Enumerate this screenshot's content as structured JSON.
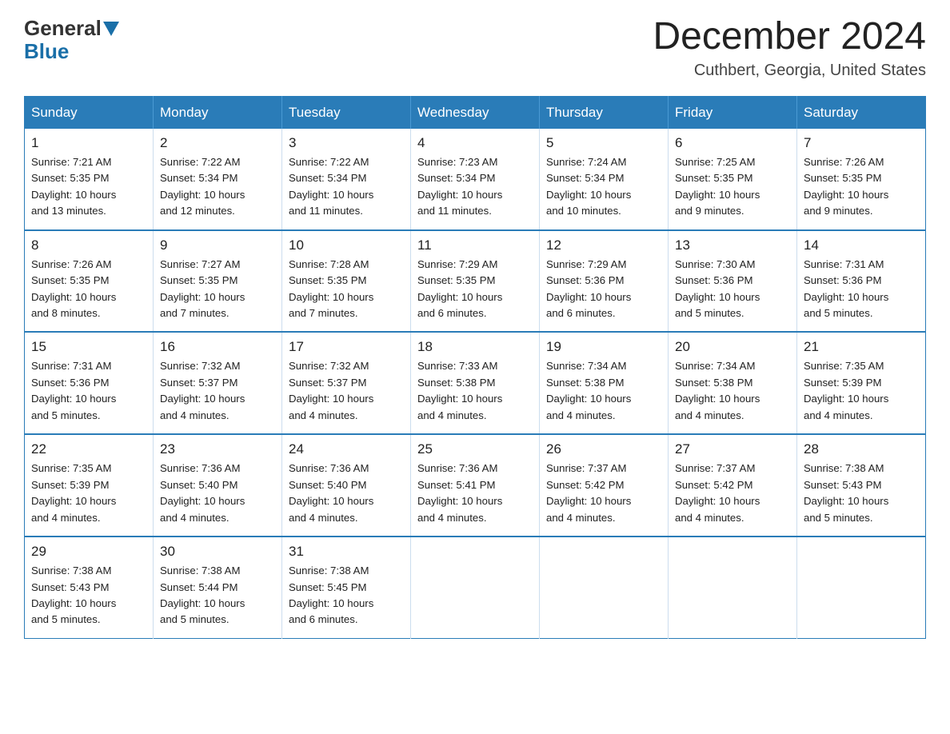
{
  "logo": {
    "general": "General",
    "blue": "Blue"
  },
  "header": {
    "title": "December 2024",
    "location": "Cuthbert, Georgia, United States"
  },
  "days_of_week": [
    "Sunday",
    "Monday",
    "Tuesday",
    "Wednesday",
    "Thursday",
    "Friday",
    "Saturday"
  ],
  "weeks": [
    [
      {
        "day": "1",
        "sunrise": "7:21 AM",
        "sunset": "5:35 PM",
        "daylight": "10 hours and 13 minutes."
      },
      {
        "day": "2",
        "sunrise": "7:22 AM",
        "sunset": "5:34 PM",
        "daylight": "10 hours and 12 minutes."
      },
      {
        "day": "3",
        "sunrise": "7:22 AM",
        "sunset": "5:34 PM",
        "daylight": "10 hours and 11 minutes."
      },
      {
        "day": "4",
        "sunrise": "7:23 AM",
        "sunset": "5:34 PM",
        "daylight": "10 hours and 11 minutes."
      },
      {
        "day": "5",
        "sunrise": "7:24 AM",
        "sunset": "5:34 PM",
        "daylight": "10 hours and 10 minutes."
      },
      {
        "day": "6",
        "sunrise": "7:25 AM",
        "sunset": "5:35 PM",
        "daylight": "10 hours and 9 minutes."
      },
      {
        "day": "7",
        "sunrise": "7:26 AM",
        "sunset": "5:35 PM",
        "daylight": "10 hours and 9 minutes."
      }
    ],
    [
      {
        "day": "8",
        "sunrise": "7:26 AM",
        "sunset": "5:35 PM",
        "daylight": "10 hours and 8 minutes."
      },
      {
        "day": "9",
        "sunrise": "7:27 AM",
        "sunset": "5:35 PM",
        "daylight": "10 hours and 7 minutes."
      },
      {
        "day": "10",
        "sunrise": "7:28 AM",
        "sunset": "5:35 PM",
        "daylight": "10 hours and 7 minutes."
      },
      {
        "day": "11",
        "sunrise": "7:29 AM",
        "sunset": "5:35 PM",
        "daylight": "10 hours and 6 minutes."
      },
      {
        "day": "12",
        "sunrise": "7:29 AM",
        "sunset": "5:36 PM",
        "daylight": "10 hours and 6 minutes."
      },
      {
        "day": "13",
        "sunrise": "7:30 AM",
        "sunset": "5:36 PM",
        "daylight": "10 hours and 5 minutes."
      },
      {
        "day": "14",
        "sunrise": "7:31 AM",
        "sunset": "5:36 PM",
        "daylight": "10 hours and 5 minutes."
      }
    ],
    [
      {
        "day": "15",
        "sunrise": "7:31 AM",
        "sunset": "5:36 PM",
        "daylight": "10 hours and 5 minutes."
      },
      {
        "day": "16",
        "sunrise": "7:32 AM",
        "sunset": "5:37 PM",
        "daylight": "10 hours and 4 minutes."
      },
      {
        "day": "17",
        "sunrise": "7:32 AM",
        "sunset": "5:37 PM",
        "daylight": "10 hours and 4 minutes."
      },
      {
        "day": "18",
        "sunrise": "7:33 AM",
        "sunset": "5:38 PM",
        "daylight": "10 hours and 4 minutes."
      },
      {
        "day": "19",
        "sunrise": "7:34 AM",
        "sunset": "5:38 PM",
        "daylight": "10 hours and 4 minutes."
      },
      {
        "day": "20",
        "sunrise": "7:34 AM",
        "sunset": "5:38 PM",
        "daylight": "10 hours and 4 minutes."
      },
      {
        "day": "21",
        "sunrise": "7:35 AM",
        "sunset": "5:39 PM",
        "daylight": "10 hours and 4 minutes."
      }
    ],
    [
      {
        "day": "22",
        "sunrise": "7:35 AM",
        "sunset": "5:39 PM",
        "daylight": "10 hours and 4 minutes."
      },
      {
        "day": "23",
        "sunrise": "7:36 AM",
        "sunset": "5:40 PM",
        "daylight": "10 hours and 4 minutes."
      },
      {
        "day": "24",
        "sunrise": "7:36 AM",
        "sunset": "5:40 PM",
        "daylight": "10 hours and 4 minutes."
      },
      {
        "day": "25",
        "sunrise": "7:36 AM",
        "sunset": "5:41 PM",
        "daylight": "10 hours and 4 minutes."
      },
      {
        "day": "26",
        "sunrise": "7:37 AM",
        "sunset": "5:42 PM",
        "daylight": "10 hours and 4 minutes."
      },
      {
        "day": "27",
        "sunrise": "7:37 AM",
        "sunset": "5:42 PM",
        "daylight": "10 hours and 4 minutes."
      },
      {
        "day": "28",
        "sunrise": "7:38 AM",
        "sunset": "5:43 PM",
        "daylight": "10 hours and 5 minutes."
      }
    ],
    [
      {
        "day": "29",
        "sunrise": "7:38 AM",
        "sunset": "5:43 PM",
        "daylight": "10 hours and 5 minutes."
      },
      {
        "day": "30",
        "sunrise": "7:38 AM",
        "sunset": "5:44 PM",
        "daylight": "10 hours and 5 minutes."
      },
      {
        "day": "31",
        "sunrise": "7:38 AM",
        "sunset": "5:45 PM",
        "daylight": "10 hours and 6 minutes."
      },
      null,
      null,
      null,
      null
    ]
  ],
  "labels": {
    "sunrise": "Sunrise:",
    "sunset": "Sunset:",
    "daylight": "Daylight:"
  }
}
